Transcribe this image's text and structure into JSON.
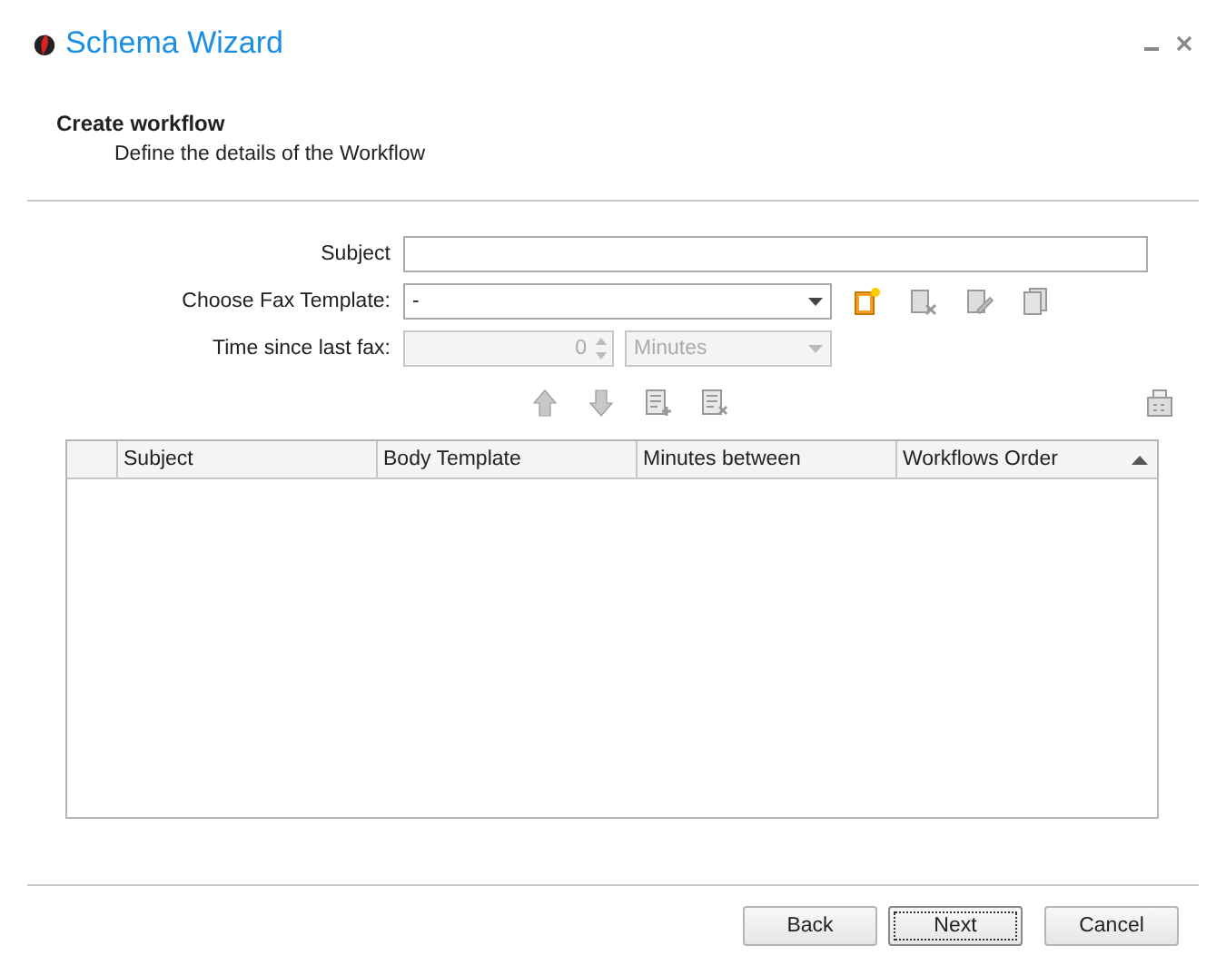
{
  "window": {
    "title": "Schema Wizard"
  },
  "header": {
    "title": "Create workflow",
    "subtitle": "Define the details of the Workflow"
  },
  "form": {
    "subject": {
      "label": "Subject"
    },
    "fax_template": {
      "label": "Choose Fax Template:",
      "value": "-",
      "disabled": false
    },
    "template_tools": [
      {
        "kind": "new",
        "disabled": false
      },
      {
        "kind": "delete",
        "disabled": true
      },
      {
        "kind": "edit",
        "disabled": true
      },
      {
        "kind": "copy",
        "disabled": true
      }
    ],
    "time_since": {
      "label": "Time since last fax:",
      "value": "0",
      "unit": "Minutes",
      "disabled": true
    }
  },
  "grid_tools": [
    {
      "kind": "up",
      "disabled": true
    },
    {
      "kind": "down",
      "disabled": true
    },
    {
      "kind": "add",
      "disabled": true
    },
    {
      "kind": "remove",
      "disabled": true
    }
  ],
  "table": {
    "columns": [
      {
        "label": "Subject",
        "sorted": false
      },
      {
        "label": "Body Template",
        "sorted": false
      },
      {
        "label": "Minutes between",
        "sorted": false
      },
      {
        "label": "Workflows Order",
        "sorted": true
      }
    ]
  },
  "buttons": [
    {
      "label": "Back",
      "focused": false
    },
    {
      "label": "Next",
      "focused": true
    },
    {
      "label": "Cancel",
      "focused": false
    }
  ]
}
